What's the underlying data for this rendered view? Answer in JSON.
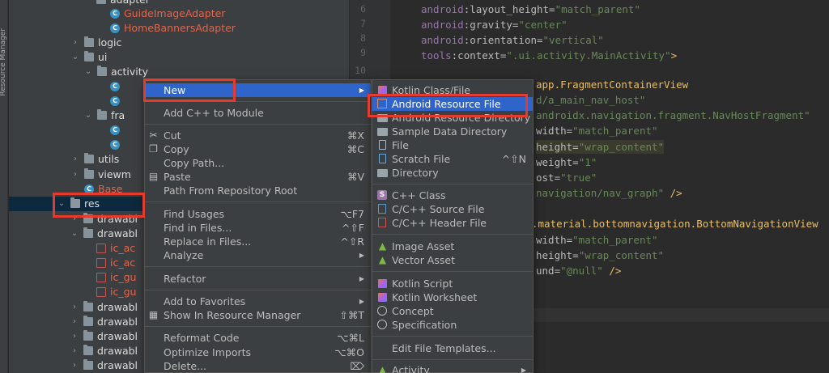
{
  "sidebar_label": "Resource Manager",
  "tree": [
    {
      "text": "adapter",
      "style": "white",
      "icon": "folder-icon",
      "arrow": ""
    },
    {
      "text": "GuideImageAdapter",
      "style": "red",
      "icon": "class-icon",
      "arrow": ""
    },
    {
      "text": "HomeBannersAdapter",
      "style": "red",
      "icon": "class-icon",
      "arrow": ""
    },
    {
      "text": "logic",
      "style": "white",
      "icon": "folder-icon",
      "arrow": "›"
    },
    {
      "text": "ui",
      "style": "white",
      "icon": "folder-icon",
      "arrow": "⌄"
    },
    {
      "text": "activity",
      "style": "white",
      "icon": "folder-icon",
      "arrow": "⌄"
    },
    {
      "text": "",
      "style": "white",
      "icon": "class-icon",
      "arrow": ""
    },
    {
      "text": "",
      "style": "white",
      "icon": "class-icon",
      "arrow": ""
    },
    {
      "text": "fra",
      "style": "white",
      "icon": "folder-icon",
      "arrow": "⌄"
    },
    {
      "text": "",
      "style": "white",
      "icon": "class-icon",
      "arrow": ""
    },
    {
      "text": "",
      "style": "white",
      "icon": "class-icon",
      "arrow": ""
    },
    {
      "text": "utils",
      "style": "white",
      "icon": "folder-icon",
      "arrow": "›"
    },
    {
      "text": "viewm",
      "style": "white",
      "icon": "folder-icon",
      "arrow": "›"
    },
    {
      "text": "Base",
      "style": "red",
      "icon": "class-icon",
      "arrow": ""
    },
    {
      "text": "res",
      "style": "white",
      "icon": "res-folder-icon",
      "arrow": "⌄"
    },
    {
      "text": "drawabl",
      "style": "white",
      "icon": "folder-icon",
      "arrow": "›"
    },
    {
      "text": "drawabl",
      "style": "white",
      "icon": "folder-icon",
      "arrow": "⌄"
    },
    {
      "text": "ic_ac",
      "style": "red",
      "icon": "image-icon",
      "arrow": ""
    },
    {
      "text": "ic_ac",
      "style": "red",
      "icon": "image-icon",
      "arrow": ""
    },
    {
      "text": "ic_gu",
      "style": "red",
      "icon": "image-icon",
      "arrow": ""
    },
    {
      "text": "ic_gu",
      "style": "red",
      "icon": "image-icon",
      "arrow": ""
    },
    {
      "text": "drawabl",
      "style": "white",
      "icon": "folder-icon",
      "arrow": "›"
    },
    {
      "text": "drawabl",
      "style": "white",
      "icon": "folder-icon",
      "arrow": "›"
    },
    {
      "text": "drawabl",
      "style": "white",
      "icon": "folder-icon",
      "arrow": "›"
    },
    {
      "text": "drawabl",
      "style": "white",
      "icon": "folder-icon",
      "arrow": "›"
    },
    {
      "text": "drawabl",
      "style": "white",
      "icon": "folder-icon",
      "arrow": "›"
    }
  ],
  "line_numbers": [
    "6",
    "7",
    "8",
    "9",
    "10"
  ],
  "code": {
    "l1": {
      "ns": "android",
      "attr": ":layout_height=",
      "val": "\"match_parent\""
    },
    "l2": {
      "ns": "android",
      "attr": ":gravity=",
      "val": "\"center\""
    },
    "l3": {
      "ns": "android",
      "attr": ":orientation=",
      "val": "\"vertical\""
    },
    "l4": {
      "ns": "tools",
      "attr": ":context=",
      "val": "\".ui.activity.MainActivity\"",
      "end": ">"
    },
    "l5": "app.FragmentContainerView",
    "l6": "d/a_main_nav_host\"",
    "l7": "androidx.navigation.fragment.NavHostFragment\"",
    "l8": {
      "attr": "width=",
      "val": "\"match_parent\""
    },
    "l9": {
      "attr": "height=",
      "val": "\"wrap_content\""
    },
    "l10": {
      "attr": "weight=",
      "val": "\"1\""
    },
    "l11": {
      "attr": "ost=",
      "val": "\"true\""
    },
    "l12": {
      "val": "navigation/nav_graph\"",
      "end": " />"
    },
    "l13": ".material.bottomnavigation.BottomNavigationView",
    "l14": {
      "attr": "width=",
      "val": "\"match_parent\""
    },
    "l15": {
      "attr": "height=",
      "val": "\"wrap_content\""
    },
    "l16": {
      "attr": "und=",
      "val": "\"@null\"",
      "end": " />"
    }
  },
  "context_menu": {
    "new": "New",
    "add_cpp": "Add C++ to Module",
    "cut": "Cut",
    "cut_sc": "⌘X",
    "copy": "Copy",
    "copy_sc": "⌘C",
    "copy_path": "Copy Path...",
    "paste": "Paste",
    "paste_sc": "⌘V",
    "path_from_repo": "Path From Repository Root",
    "find_usages": "Find Usages",
    "find_usages_sc": "⌥F7",
    "find_in_files": "Find in Files...",
    "find_in_files_sc": "^⇧F",
    "replace_in_files": "Replace in Files...",
    "replace_in_files_sc": "^⇧R",
    "analyze": "Analyze",
    "refactor": "Refactor",
    "add_favorites": "Add to Favorites",
    "show_resource_manager": "Show In Resource Manager",
    "show_resource_manager_sc": "⇧⌘T",
    "reformat": "Reformat Code",
    "reformat_sc": "⌥⌘L",
    "optimize": "Optimize Imports",
    "optimize_sc": "⌥⌘O",
    "delete": "Delete...",
    "delete_sc": "⌦"
  },
  "submenu": {
    "kotlin_class": "Kotlin Class/File",
    "android_resource_file": "Android Resource File",
    "android_resource_directory": "Android Resource Directory",
    "sample_data_directory": "Sample Data Directory",
    "file": "File",
    "scratch_file": "Scratch File",
    "scratch_file_sc": "^⇧N",
    "directory": "Directory",
    "cpp_class": "C++ Class",
    "cpp_source": "C/C++ Source File",
    "cpp_header": "C/C++ Header File",
    "image_asset": "Image Asset",
    "vector_asset": "Vector Asset",
    "kotlin_script": "Kotlin Script",
    "kotlin_worksheet": "Kotlin Worksheet",
    "concept": "Concept",
    "specification": "Specification",
    "edit_templates": "Edit File Templates...",
    "activity": "Activity"
  },
  "colors": {
    "accent": "#2f65ca",
    "highlight_box": "#e53b2e",
    "selection": "#0d293e"
  }
}
